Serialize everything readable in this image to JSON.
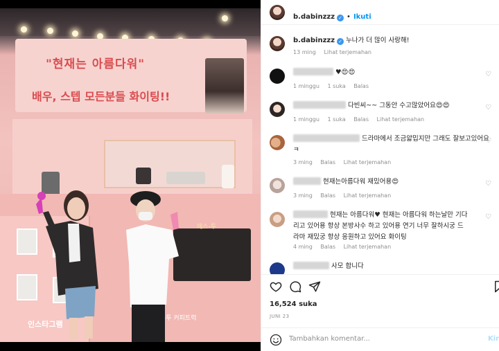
{
  "photo": {
    "banner_line1": "\"현재는 아름다워\"",
    "banner_line2": "배우, 스텝 모든분들 화이팅!!",
    "sign_middle": "에스-투",
    "sign_bottom_left": "인스타그램",
    "sign_bottom_right": "채널  에스-투 커피트럭"
  },
  "header": {
    "username": "b.dabinzzz",
    "follow_label": "Ikuti"
  },
  "caption": {
    "username": "b.dabinzzz",
    "text": "누나가 더 많이 사랑해!",
    "time": "13 ming",
    "translate": "Lihat terjemahan"
  },
  "comments": [
    {
      "text": "",
      "emoji": "♥😍😍",
      "time": "1 minggu",
      "likes": "1 suka",
      "reply": "Balas",
      "translate": ""
    },
    {
      "text": "다빈씨~~ 그동안 수고많았어요😍😍",
      "time": "1 minggu",
      "likes": "1 suka",
      "reply": "Balas",
      "translate": "Lihat terjemahan"
    },
    {
      "text": "드라마에서 조금얇밉지만 그래도 잘보고있어요",
      "text2": "ㅋ",
      "time": "3 ming",
      "likes": "",
      "reply": "Balas",
      "translate": "Lihat terjemahan"
    },
    {
      "text": "현재는아름다워 재밌어용😍",
      "time": "3 ming",
      "likes": "",
      "reply": "Balas",
      "translate": "Lihat terjemahan"
    },
    {
      "text": "현재는 아름다워♥ 현재는 아름다워 하는날만 기다",
      "text2": "리고 있어용 항상 본방사수 하고 있어용 연기 너무 잘하시궁 드",
      "text3": "라마 재밌궁 항상 응원하고 있어요 화이팅",
      "time": "4 ming",
      "likes": "",
      "reply": "Balas",
      "translate": "Lihat terjemahan"
    },
    {
      "text": "사모 합니다",
      "time": "",
      "likes": "",
      "reply": "",
      "translate": ""
    }
  ],
  "footer": {
    "likes": "16,524 suka",
    "date": "JUNI 23",
    "input_placeholder": "Tambahkan komentar...",
    "post_label": "Kirim"
  },
  "colors": {
    "accent": "#0095f6",
    "verified": "#3897f0",
    "muted": "#8e8e8e"
  }
}
